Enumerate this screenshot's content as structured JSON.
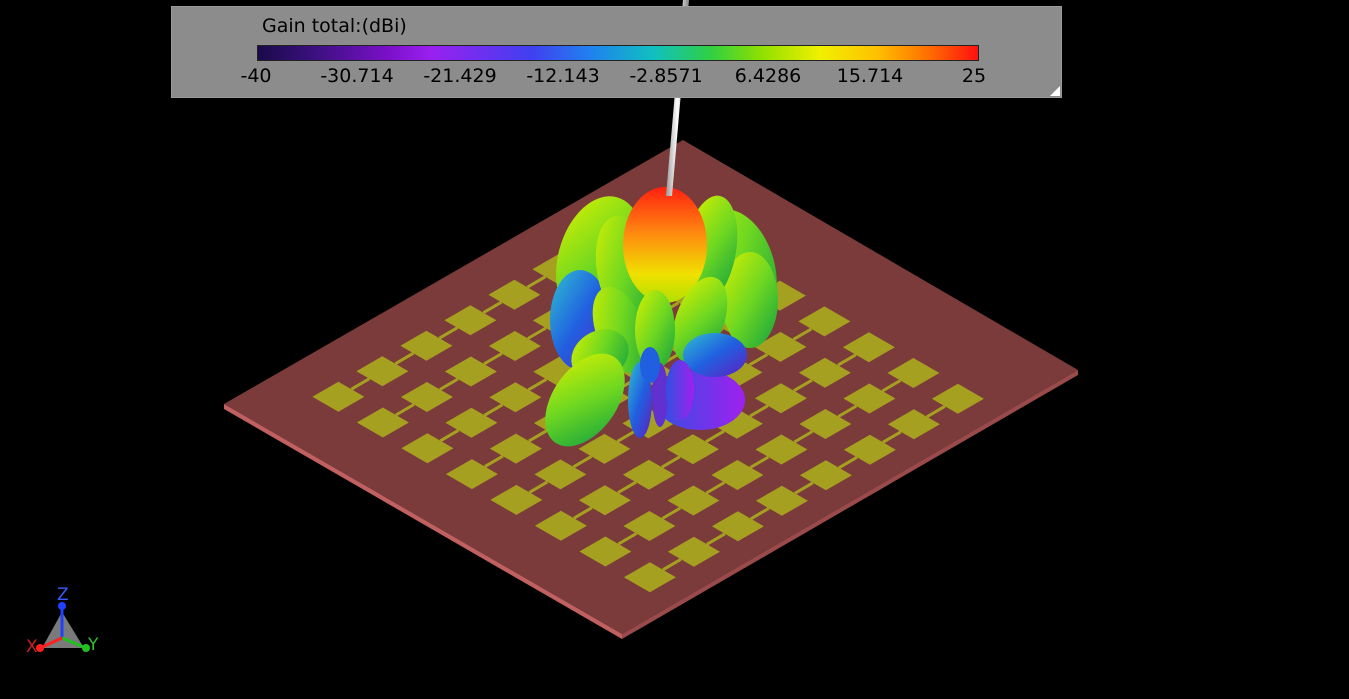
{
  "legend": {
    "title": "Gain total:(dBi)",
    "ticks": [
      "-40",
      "-30.714",
      "-21.429",
      "-12.143",
      "-2.8571",
      "6.4286",
      "15.714",
      "25"
    ]
  },
  "axes_triad": {
    "z": "Z",
    "y": "Y",
    "x": "X"
  },
  "colors": {
    "substrate": "#7a3a3a",
    "patch": "#a6a020",
    "background": "#000000"
  }
}
